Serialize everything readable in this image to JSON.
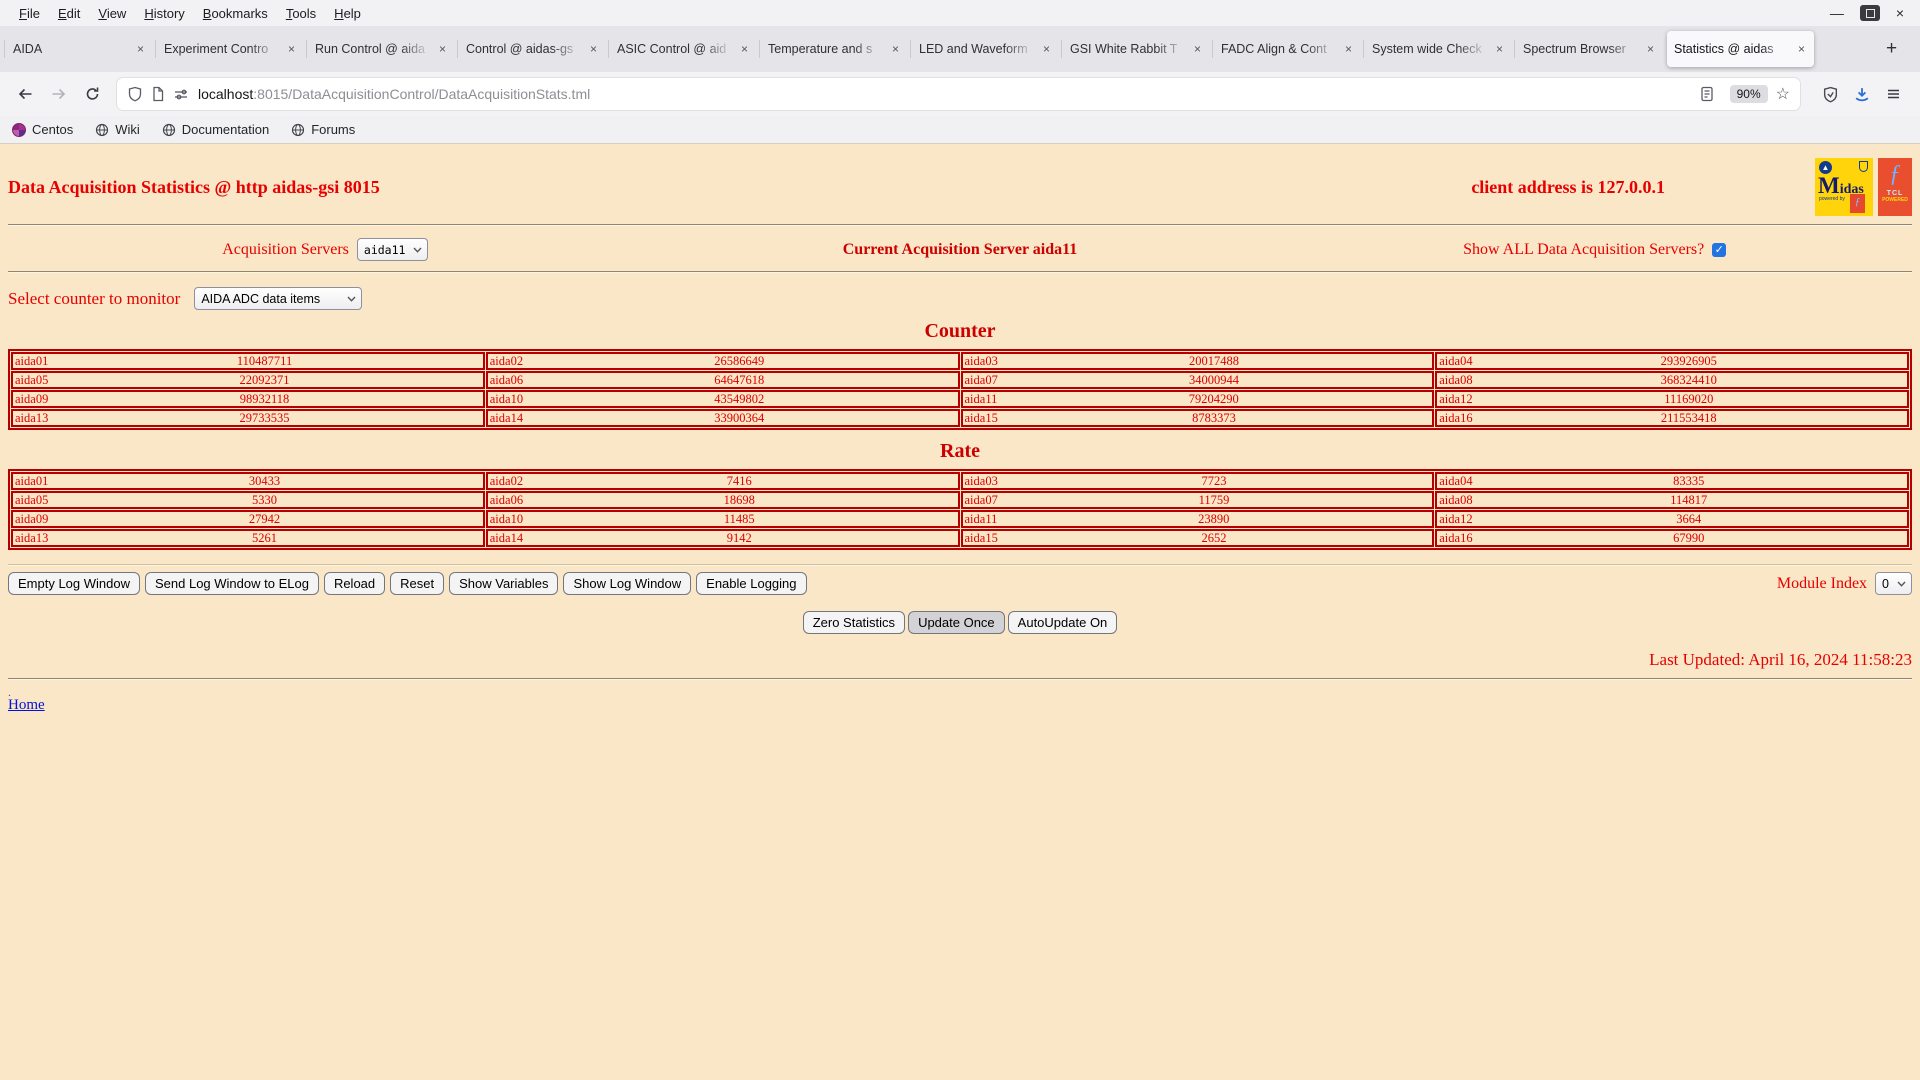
{
  "window": {
    "menu_items": [
      "File",
      "Edit",
      "View",
      "History",
      "Bookmarks",
      "Tools",
      "Help"
    ],
    "minimize_glyph": "—",
    "close_glyph": "×"
  },
  "tabs": {
    "items": [
      {
        "label": "AIDA"
      },
      {
        "label": "Experiment Contro"
      },
      {
        "label": "Run Control @ aida"
      },
      {
        "label": "Control @ aidas-gs"
      },
      {
        "label": "ASIC Control @ aid"
      },
      {
        "label": "Temperature and s"
      },
      {
        "label": "LED and Waveform"
      },
      {
        "label": "GSI White Rabbit T"
      },
      {
        "label": "FADC Align & Cont"
      },
      {
        "label": "System wide Check"
      },
      {
        "label": "Spectrum Browser"
      },
      {
        "label": "Statistics @ aidas"
      }
    ],
    "close_glyph": "×",
    "new_tab_glyph": "+"
  },
  "navbar": {
    "url_host": "localhost",
    "url_rest": ":8015/DataAcquisitionControl/DataAcquisitionStats.tml",
    "zoom_badge": "90%",
    "star_glyph": "☆"
  },
  "bookmarks": {
    "items": [
      "Centos",
      "Wiki",
      "Documentation",
      "Forums"
    ]
  },
  "page": {
    "title": "Data Acquisition Statistics @ http aidas-gsi 8015",
    "client_address": "client address is 127.0.0.1",
    "acquisition_servers_label": "Acquisition Servers",
    "acquisition_server_selected": "aida11",
    "current_server_text": "Current Acquisition Server aida11",
    "show_all_label": "Show ALL Data Acquisition Servers?",
    "checkbox_glyph": "✓",
    "select_counter_label": "Select counter to monitor",
    "counter_monitor_selected": "AIDA ADC data items",
    "counter": {
      "heading": "Counter",
      "rows": [
        [
          "aida01",
          "110487711",
          "aida02",
          "26586649",
          "aida03",
          "20017488",
          "aida04",
          "293926905"
        ],
        [
          "aida05",
          "22092371",
          "aida06",
          "64647618",
          "aida07",
          "34000944",
          "aida08",
          "368324410"
        ],
        [
          "aida09",
          "98932118",
          "aida10",
          "43549802",
          "aida11",
          "79204290",
          "aida12",
          "11169020"
        ],
        [
          "aida13",
          "29733535",
          "aida14",
          "33900364",
          "aida15",
          "8783373",
          "aida16",
          "211553418"
        ]
      ]
    },
    "rate": {
      "heading": "Rate",
      "rows": [
        [
          "aida01",
          "30433",
          "aida02",
          "7416",
          "aida03",
          "7723",
          "aida04",
          "83335"
        ],
        [
          "aida05",
          "5330",
          "aida06",
          "18698",
          "aida07",
          "11759",
          "aida08",
          "114817"
        ],
        [
          "aida09",
          "27942",
          "aida10",
          "11485",
          "aida11",
          "23890",
          "aida12",
          "3664"
        ],
        [
          "aida13",
          "5261",
          "aida14",
          "9142",
          "aida15",
          "2652",
          "aida16",
          "67990"
        ]
      ]
    },
    "log_buttons": [
      "Empty Log Window",
      "Send Log Window to ELog",
      "Reload",
      "Reset",
      "Show Variables",
      "Show Log Window",
      "Enable Logging"
    ],
    "module_index_label": "Module Index",
    "module_index_selected": "0",
    "action_buttons": [
      "Zero Statistics",
      "Update Once",
      "AutoUpdate On"
    ],
    "last_updated": "Last Updated: April 16, 2024 11:58:23",
    "stray_dot": ".",
    "home_link": "Home",
    "logos": {
      "midas_text": "Midas",
      "midas_powered": "powered by",
      "midas_badge": "ƒ",
      "tcl_feather": "ƒ",
      "tcl_text": "TCL",
      "tcl_powered": "POWERED"
    }
  },
  "colors": {
    "page_bg": "#FAE7C8",
    "accent_red": "#E60000",
    "table_border": "#B40000",
    "link_blue": "#0011DD",
    "download_blue": "#2B6FD9",
    "checkbox_blue": "#2374E1"
  }
}
